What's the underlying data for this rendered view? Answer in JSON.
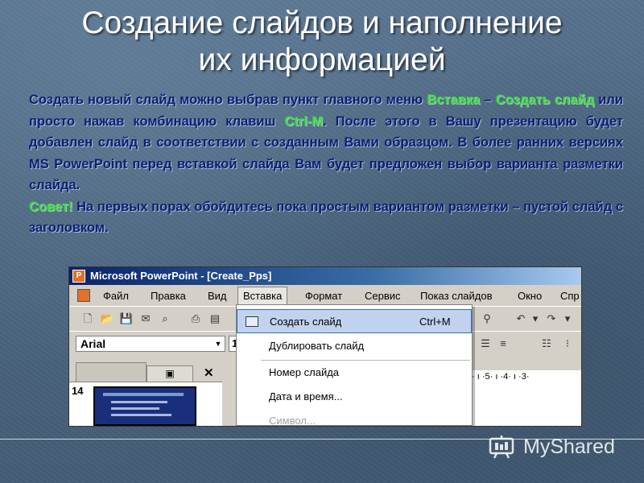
{
  "slide": {
    "title_line1": "Создание слайдов и наполнение",
    "title_line2": "их информацией",
    "para1": {
      "t1": "Создать новый слайд можно выбрав пункт главного меню ",
      "h1": "Вставка",
      "t2": " – ",
      "h2": "Создать слайд",
      "t3": " или просто нажав комбинацию клавиш ",
      "h3": "Ctrl-M",
      "t4": ". После этого в Вашу презентацию будет добавлен слайд в соответствии с созданным Вами образцом. В более ранних версиях  MS PowerPoint перед вставкой слайда Вам будет предложен выбор варианта разметки слайда."
    },
    "para2": {
      "h1": "Совет!",
      "t1": " На первых порах обойдитесь пока простым вариантом разметки – пустой слайд с заголовком."
    }
  },
  "screenshot": {
    "window_title": "Microsoft PowerPoint - [Create_Pps]",
    "menu": [
      "Файл",
      "Правка",
      "Вид",
      "Вставка",
      "Формат",
      "Сервис",
      "Показ слайдов",
      "Окно",
      "Спр"
    ],
    "font_name": "Arial",
    "font_size": "1",
    "slide_number": "14",
    "ruler_text": "· ı ·5· ı ·4· ı ·3·",
    "dropdown_items": [
      {
        "label": "Создать слайд",
        "shortcut": "Ctrl+M"
      },
      {
        "label": "Дублировать слайд",
        "shortcut": ""
      },
      {
        "label": "Номер слайда",
        "shortcut": ""
      },
      {
        "label": "Дата и время...",
        "shortcut": ""
      },
      {
        "label": "Символ...",
        "shortcut": ""
      }
    ],
    "close_glyph": "✕"
  },
  "watermark": {
    "text": "MyShared"
  },
  "colors": {
    "background": "#4a6580",
    "body_text": "#0b1e7a",
    "highlight": "#35e23a",
    "title": "#ffffff"
  }
}
